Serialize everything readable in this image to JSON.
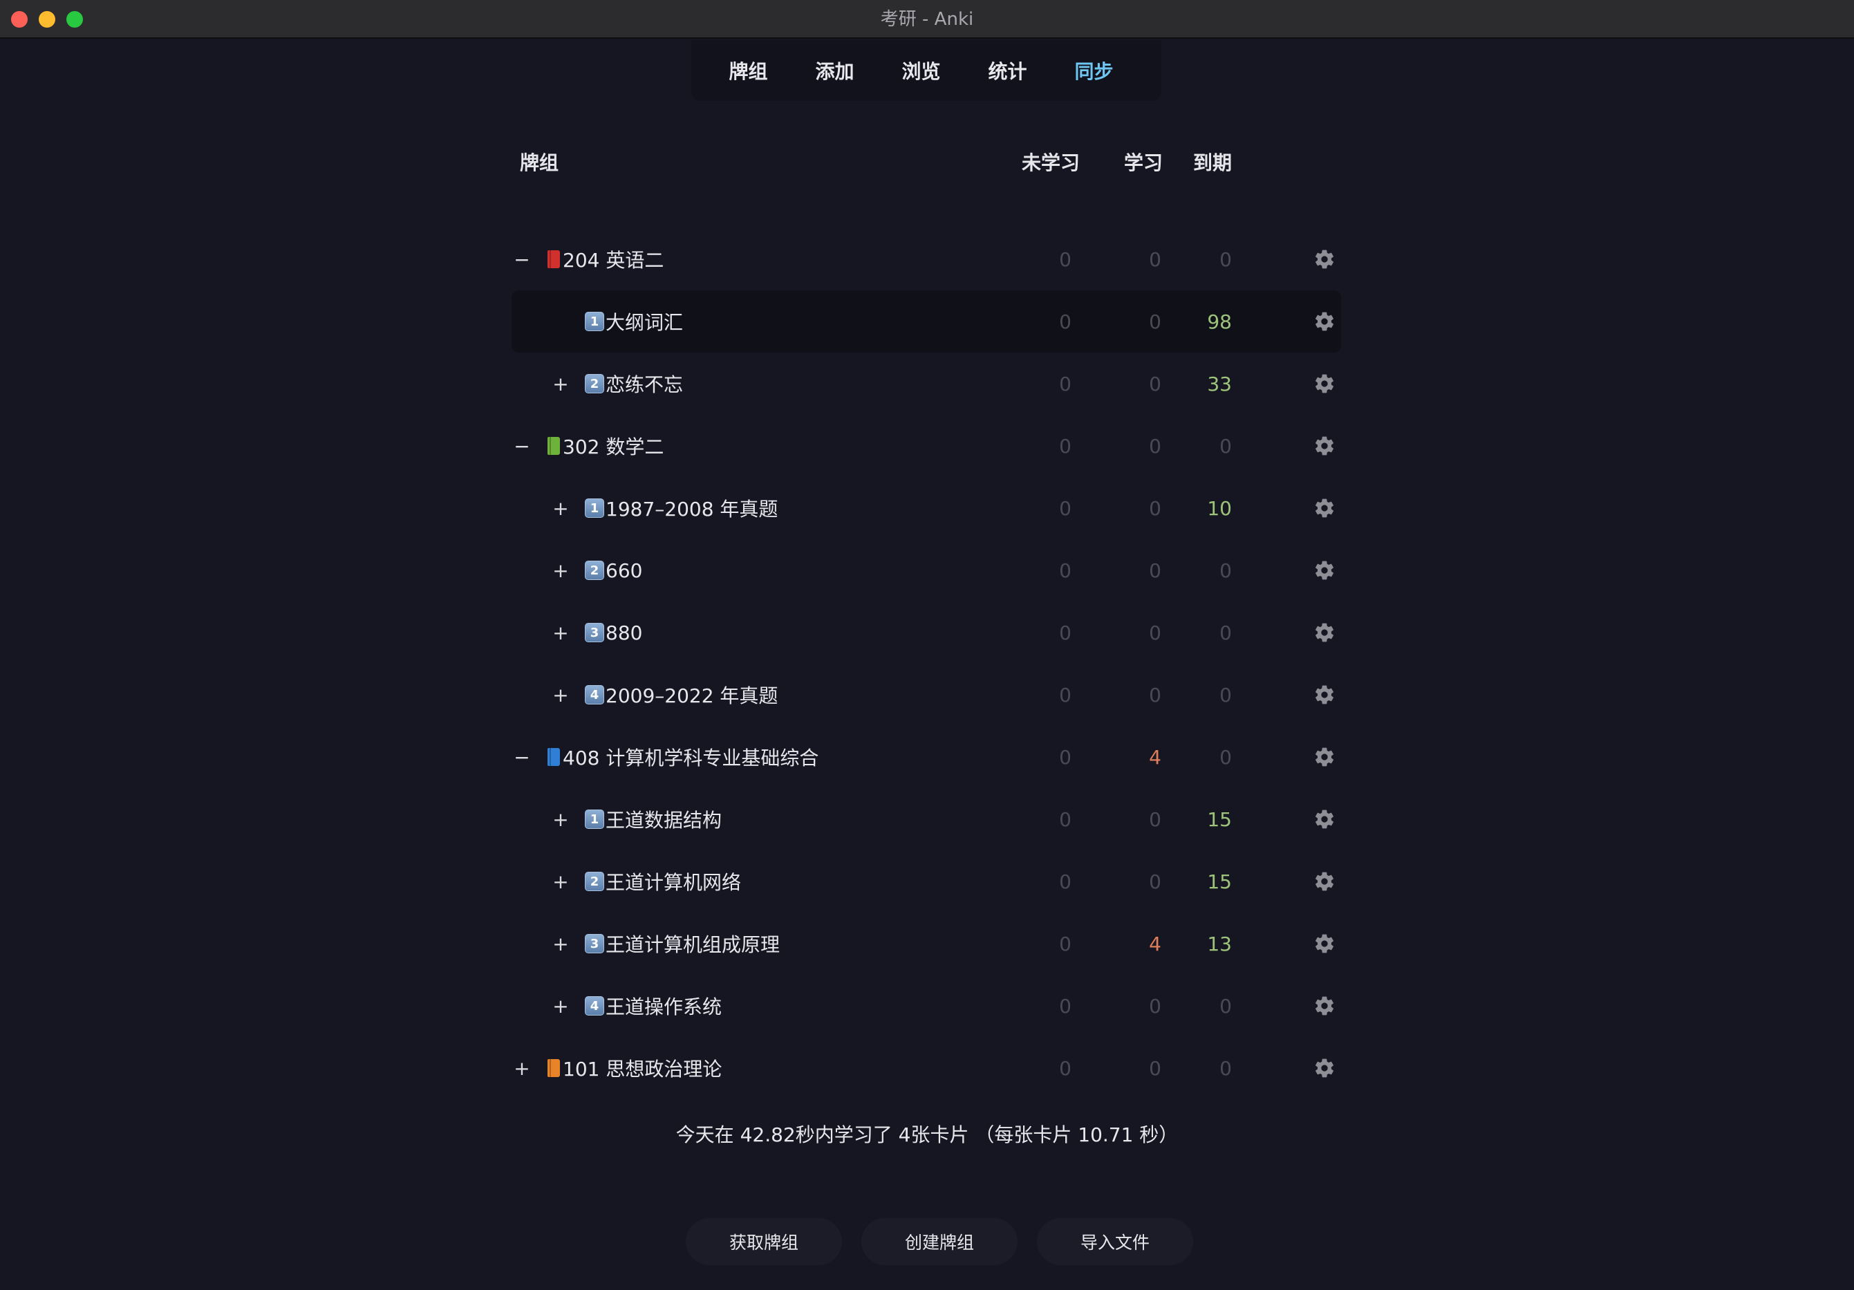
{
  "window": {
    "title": "考研 - Anki"
  },
  "toolbar": {
    "decks": "牌组",
    "add": "添加",
    "browse": "浏览",
    "stats": "统计",
    "sync": "同步"
  },
  "table_header": {
    "deck": "牌组",
    "new": "未学习",
    "learn": "学习",
    "due": "到期"
  },
  "colors": {
    "due_green": "#9ec47a",
    "learn_red": "#e07d5a",
    "zero_gray": "#4a4a55",
    "sync_blue": "#6ec6f2"
  },
  "decks": [
    {
      "expander": "−",
      "icon": "red-book-icon",
      "icon_color": "#d0312d",
      "name": "204 英语二",
      "level": 0,
      "new": "0",
      "learn": "0",
      "due": "0"
    },
    {
      "expander": "",
      "icon": "keycap-1-icon",
      "key": "1",
      "name": "大纲词汇",
      "level": 1,
      "new": "0",
      "learn": "0",
      "due": "98",
      "selected": true
    },
    {
      "expander": "+",
      "icon": "keycap-2-icon",
      "key": "2",
      "name": "恋练不忘",
      "level": 1,
      "new": "0",
      "learn": "0",
      "due": "33"
    },
    {
      "expander": "−",
      "icon": "green-book-icon",
      "icon_color": "#6fb23a",
      "name": "302 数学二",
      "level": 0,
      "new": "0",
      "learn": "0",
      "due": "0"
    },
    {
      "expander": "+",
      "icon": "keycap-1-icon",
      "key": "1",
      "name": "1987–2008 年真题",
      "level": 1,
      "new": "0",
      "learn": "0",
      "due": "10"
    },
    {
      "expander": "+",
      "icon": "keycap-2-icon",
      "key": "2",
      "name": "660",
      "level": 1,
      "new": "0",
      "learn": "0",
      "due": "0"
    },
    {
      "expander": "+",
      "icon": "keycap-3-icon",
      "key": "3",
      "name": "880",
      "level": 1,
      "new": "0",
      "learn": "0",
      "due": "0"
    },
    {
      "expander": "+",
      "icon": "keycap-4-icon",
      "key": "4",
      "name": "2009–2022 年真题",
      "level": 1,
      "new": "0",
      "learn": "0",
      "due": "0"
    },
    {
      "expander": "−",
      "icon": "blue-book-icon",
      "icon_color": "#2f7fd4",
      "name": "408 计算机学科专业基础综合",
      "level": 0,
      "new": "0",
      "learn": "4",
      "due": "0"
    },
    {
      "expander": "+",
      "icon": "keycap-1-icon",
      "key": "1",
      "name": "王道数据结构",
      "level": 1,
      "new": "0",
      "learn": "0",
      "due": "15"
    },
    {
      "expander": "+",
      "icon": "keycap-2-icon",
      "key": "2",
      "name": "王道计算机网络",
      "level": 1,
      "new": "0",
      "learn": "0",
      "due": "15"
    },
    {
      "expander": "+",
      "icon": "keycap-3-icon",
      "key": "3",
      "name": "王道计算机组成原理",
      "level": 1,
      "new": "0",
      "learn": "4",
      "due": "13"
    },
    {
      "expander": "+",
      "icon": "keycap-4-icon",
      "key": "4",
      "name": "王道操作系统",
      "level": 1,
      "new": "0",
      "learn": "0",
      "due": "0"
    },
    {
      "expander": "+",
      "icon": "orange-book-icon",
      "icon_color": "#e8832a",
      "name": "101 思想政治理论",
      "level": 0,
      "new": "0",
      "learn": "0",
      "due": "0"
    }
  ],
  "stats_text": "今天在 42.82秒内学习了 4张卡片 （每张卡片 10.71 秒）",
  "buttons": {
    "get_shared": "获取牌组",
    "create_deck": "创建牌组",
    "import_file": "导入文件"
  }
}
